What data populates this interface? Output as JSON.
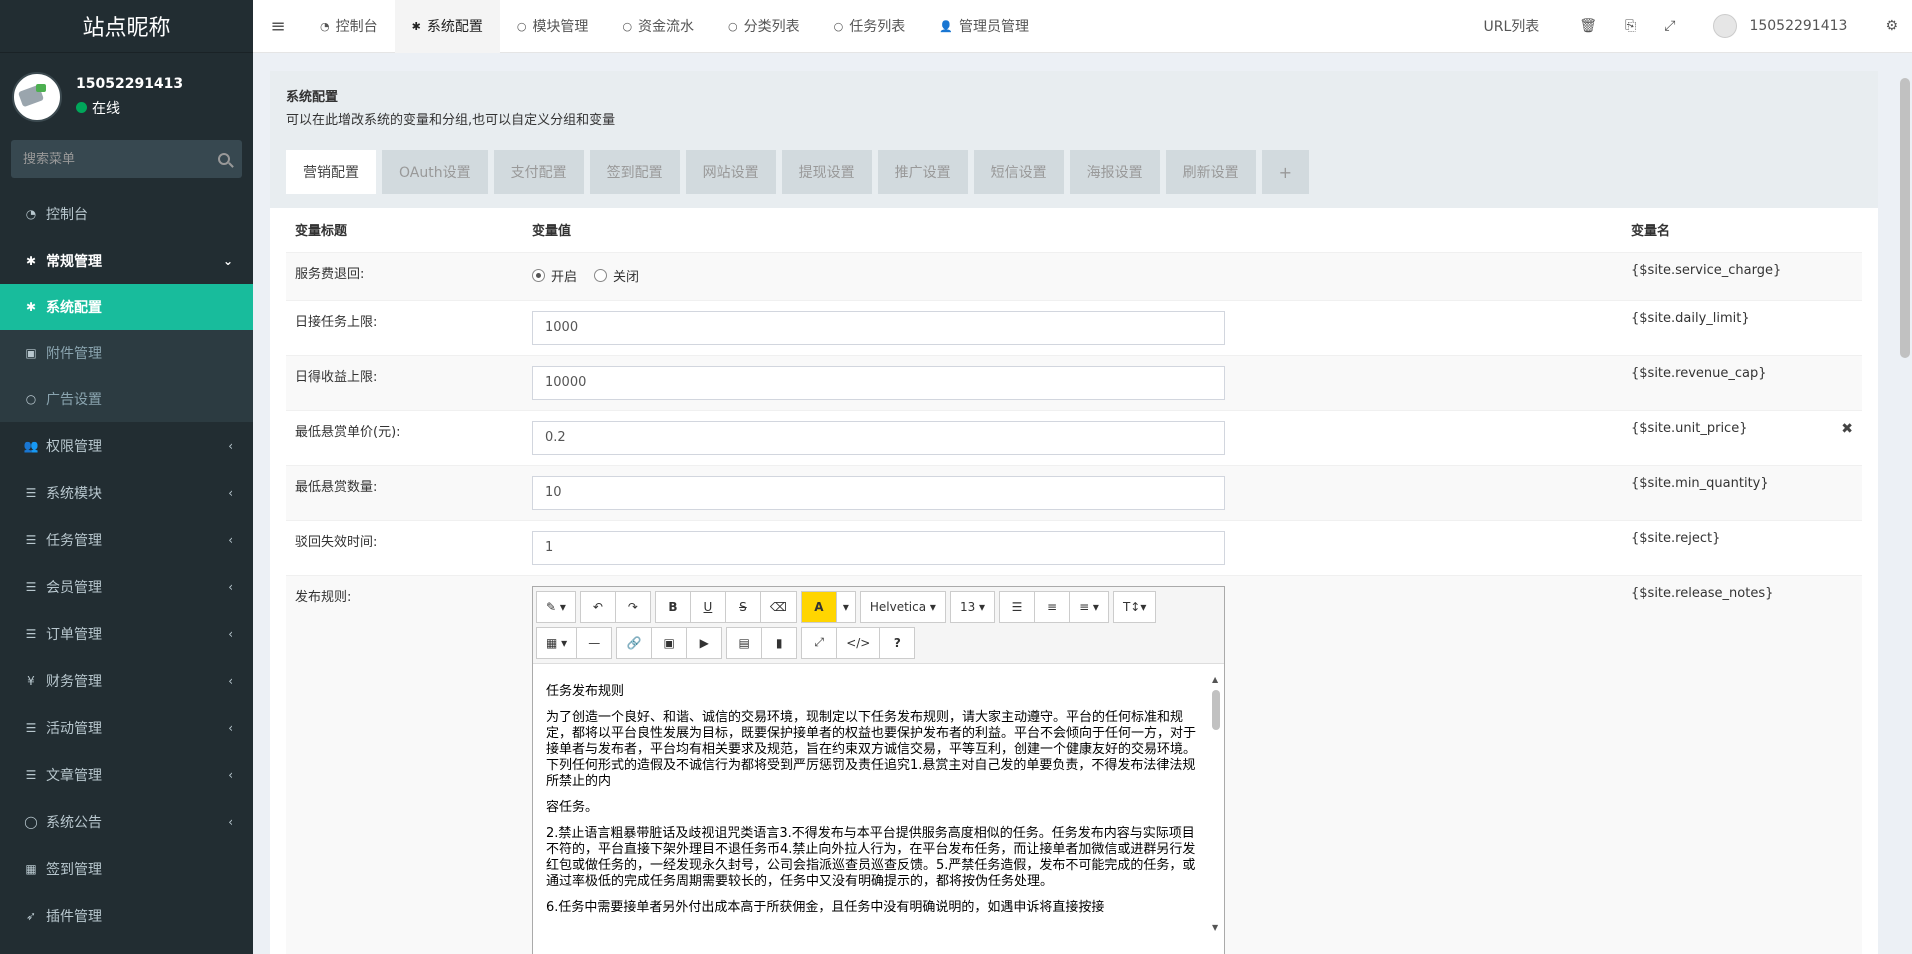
{
  "sidebar": {
    "logo": "站点昵称",
    "user": {
      "name": "15052291413",
      "status": "在线"
    },
    "search_placeholder": "搜索菜单",
    "menu": [
      {
        "label": "控制台",
        "icon": "dashboard-icon"
      },
      {
        "label": "常规管理",
        "icon": "gear-icon",
        "open": true,
        "children": [
          {
            "label": "系统配置",
            "active": true
          },
          {
            "label": "附件管理"
          },
          {
            "label": "广告设置"
          }
        ]
      },
      {
        "label": "权限管理",
        "icon": "users-icon"
      },
      {
        "label": "系统模块",
        "icon": "list-icon"
      },
      {
        "label": "任务管理",
        "icon": "list-icon"
      },
      {
        "label": "会员管理",
        "icon": "list-icon"
      },
      {
        "label": "订单管理",
        "icon": "list-icon"
      },
      {
        "label": "财务管理",
        "icon": "yen-icon"
      },
      {
        "label": "活动管理",
        "icon": "list-icon"
      },
      {
        "label": "文章管理",
        "icon": "list-icon"
      },
      {
        "label": "系统公告",
        "icon": "comment-icon"
      },
      {
        "label": "签到管理",
        "icon": "calendar-icon"
      },
      {
        "label": "插件管理",
        "icon": "rocket-icon"
      }
    ]
  },
  "topnav": {
    "tabs": [
      "控制台",
      "系统配置",
      "模块管理",
      "资金流水",
      "分类列表",
      "任务列表",
      "管理员管理"
    ],
    "url_list": "URL列表",
    "user": "15052291413"
  },
  "panel": {
    "title": "系统配置",
    "desc": "可以在此增改系统的变量和分组,也可以自定义分组和变量",
    "tabs": [
      "营销配置",
      "OAuth设置",
      "支付配置",
      "签到配置",
      "网站设置",
      "提现设置",
      "推广设置",
      "短信设置",
      "海报设置",
      "刷新设置",
      "+"
    ],
    "headers": {
      "title": "变量标题",
      "value": "变量值",
      "name": "变量名"
    },
    "rows": [
      {
        "title": "服务费退回:",
        "type": "radio",
        "options": [
          "开启",
          "关闭"
        ],
        "name": "{$site.service_charge}"
      },
      {
        "title": "日接任务上限:",
        "value": "1000",
        "name": "{$site.daily_limit}"
      },
      {
        "title": "日得收益上限:",
        "value": "10000",
        "name": "{$site.revenue_cap}"
      },
      {
        "title": "最低悬赏单价(元):",
        "value": "0.2",
        "name": "{$site.unit_price}"
      },
      {
        "title": "最低悬赏数量:",
        "value": "10",
        "name": "{$site.min_quantity}"
      },
      {
        "title": "驳回失效时间:",
        "value": "1",
        "name": "{$site.reject}"
      },
      {
        "title": "发布规则:",
        "type": "editor",
        "name": "{$site.release_notes}"
      }
    ],
    "editor": {
      "font": "Helvetica",
      "size": "13",
      "paragraphs": [
        "任务发布规则",
        "为了创造一个良好、和谐、诚信的交易环境，现制定以下任务发布规则，请大家主动遵守。平台的任何标准和规定，都将以平台良性发展为目标，既要保护接单者的权益也要保护发布者的利益。平台不会倾向于任何一方，对于接单者与发布者，平台均有相关要求及规范，旨在约束双方诚信交易，平等互利，创建一个健康友好的交易环境。下列任何形式的造假及不诚信行为都将受到严厉惩罚及责任追究1.悬赏主对自己发的单要负责，不得发布法律法规所禁止的内",
        "容任务。",
        "2.禁止语言粗暴带脏话及歧视诅咒类语言3.不得发布与本平台提供服务高度相似的任务。任务发布内容与实际项目不符的，平台直接下架外理目不退任务币4.禁止向外拉人行为，在平台发布任务，而让接单者加微信或进群另行发红包或做任务的，一经发现永久封号，公司会指派巡查员巡查反馈。5.严禁任务造假，发布不可能完成的任务，或通过率极低的完成任务周期需要较长的，任务中又没有明确提示的，都将按伪任务处理。",
        "6.任务中需要接单者另外付出成本高于所获佣金，且任务中没有明确说明的，如遇申诉将直接按接"
      ]
    }
  }
}
